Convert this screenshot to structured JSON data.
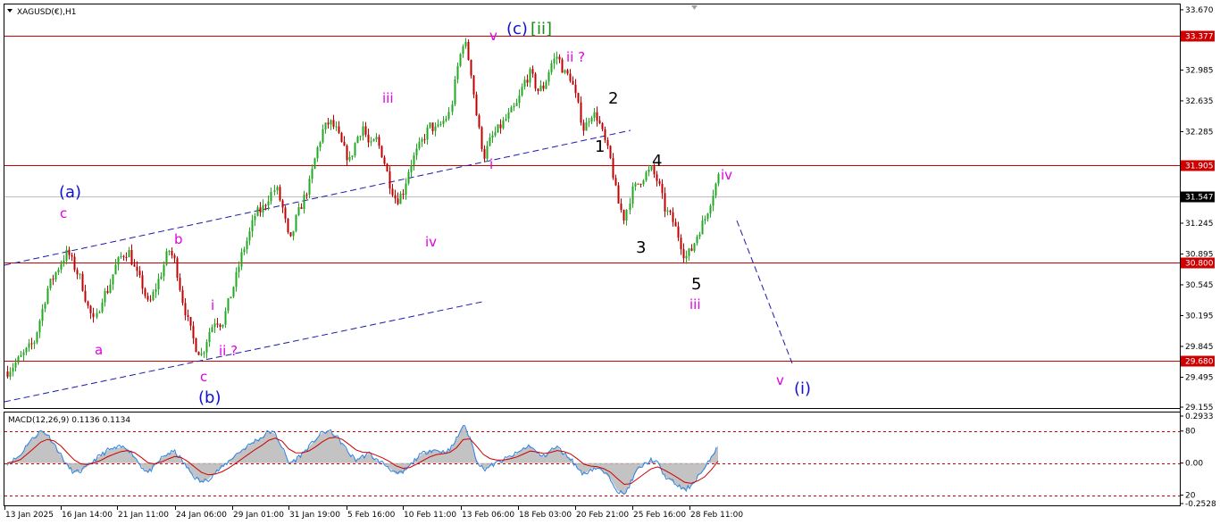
{
  "colors": {
    "frame": "#000000",
    "up_candle": "#22a822",
    "down_candle": "#c00000",
    "level": "#cc0000",
    "current_line": "#bfbfbf",
    "channel": "#1a1aaa",
    "wave_magenta": "#e000e0",
    "wave_blue": "#1010d0",
    "wave_green": "#178a17",
    "wave_black": "#000000",
    "macd_hist": "#b8b8b8",
    "macd_main": "#2a82e6",
    "macd_signal": "#cc0000"
  },
  "chart_data": {
    "type": "candlestick",
    "title": "XAGUSD(€),H1",
    "indicator_title": "MACD(12,26,9) 0.1136 0.1134",
    "y_ticks": [
      "33.670",
      "32.985",
      "32.635",
      "32.285",
      "31.245",
      "30.895",
      "30.545",
      "30.195",
      "29.845",
      "29.495",
      "29.155"
    ],
    "ylim": [
      29.155,
      33.72
    ],
    "x_ticks": [
      "13 Jan 2025",
      "16 Jan 14:00",
      "21 Jan 11:00",
      "24 Jan 06:00",
      "29 Jan 01:00",
      "31 Jan 19:00",
      "5 Feb 16:00",
      "10 Feb 11:00",
      "13 Feb 06:00",
      "18 Feb 03:00",
      "20 Feb 21:00",
      "25 Feb 16:00",
      "28 Feb 11:00"
    ],
    "levels": [
      {
        "value": 33.377,
        "label": "33.377"
      },
      {
        "value": 31.905,
        "label": "31.905"
      },
      {
        "value": 30.8,
        "label": "30.800"
      },
      {
        "value": 29.68,
        "label": "29.680"
      }
    ],
    "current_price": {
      "value": 31.547,
      "label": "31.547"
    },
    "path": [
      [
        0,
        29.56
      ],
      [
        2,
        29.72
      ],
      [
        4,
        29.9
      ],
      [
        6,
        30.5
      ],
      [
        8,
        30.8
      ],
      [
        9,
        30.92
      ],
      [
        10,
        30.75
      ],
      [
        11,
        30.6
      ],
      [
        12,
        30.3
      ],
      [
        13,
        30.1
      ],
      [
        14,
        30.4
      ],
      [
        15,
        30.5
      ],
      [
        16,
        30.75
      ],
      [
        17,
        30.88
      ],
      [
        18,
        30.93
      ],
      [
        19,
        30.7
      ],
      [
        20,
        30.55
      ],
      [
        21,
        30.3
      ],
      [
        22,
        30.5
      ],
      [
        23,
        30.7
      ],
      [
        24,
        30.95
      ],
      [
        25,
        30.8
      ],
      [
        26,
        30.4
      ],
      [
        27,
        30.1
      ],
      [
        28,
        29.85
      ],
      [
        29,
        29.74
      ],
      [
        30,
        30.0
      ],
      [
        31,
        30.15
      ],
      [
        32,
        30.1
      ],
      [
        33,
        30.35
      ],
      [
        34,
        30.6
      ],
      [
        35,
        30.9
      ],
      [
        36,
        31.1
      ],
      [
        37,
        31.35
      ],
      [
        38,
        31.4
      ],
      [
        39,
        31.55
      ],
      [
        40,
        31.65
      ],
      [
        41,
        31.4
      ],
      [
        42,
        31.0
      ],
      [
        43,
        31.3
      ],
      [
        44,
        31.5
      ],
      [
        45,
        31.7
      ],
      [
        46,
        32.05
      ],
      [
        47,
        32.3
      ],
      [
        48,
        32.4
      ],
      [
        49,
        32.3
      ],
      [
        50,
        32.1
      ],
      [
        51,
        31.95
      ],
      [
        52,
        32.2
      ],
      [
        53,
        32.35
      ],
      [
        54,
        32.1
      ],
      [
        55,
        32.2
      ],
      [
        56,
        32.0
      ],
      [
        57,
        31.7
      ],
      [
        58,
        31.5
      ],
      [
        59,
        31.6
      ],
      [
        60,
        31.9
      ],
      [
        61,
        32.05
      ],
      [
        62,
        32.2
      ],
      [
        63,
        32.35
      ],
      [
        64,
        32.3
      ],
      [
        65,
        32.4
      ],
      [
        66,
        32.5
      ],
      [
        67,
        33.0
      ],
      [
        68,
        33.35
      ],
      [
        69,
        33.0
      ],
      [
        70,
        32.4
      ],
      [
        71,
        32.0
      ],
      [
        72,
        32.2
      ],
      [
        73,
        32.3
      ],
      [
        74,
        32.4
      ],
      [
        75,
        32.5
      ],
      [
        76,
        32.6
      ],
      [
        77,
        32.85
      ],
      [
        78,
        32.95
      ],
      [
        79,
        32.75
      ],
      [
        80,
        32.8
      ],
      [
        81,
        33.05
      ],
      [
        82,
        33.15
      ],
      [
        83,
        32.95
      ],
      [
        84,
        32.9
      ],
      [
        85,
        32.6
      ],
      [
        86,
        32.3
      ],
      [
        87,
        32.5
      ],
      [
        88,
        32.45
      ],
      [
        89,
        32.2
      ],
      [
        90,
        31.95
      ],
      [
        91,
        31.5
      ],
      [
        92,
        31.3
      ],
      [
        93,
        31.6
      ],
      [
        94,
        31.7
      ],
      [
        95,
        31.8
      ],
      [
        96,
        31.85
      ],
      [
        97,
        31.7
      ],
      [
        98,
        31.4
      ],
      [
        99,
        31.3
      ],
      [
        100,
        31.1
      ],
      [
        101,
        30.85
      ],
      [
        102,
        30.95
      ],
      [
        103,
        31.15
      ],
      [
        104,
        31.3
      ],
      [
        105,
        31.55
      ],
      [
        106,
        31.78
      ]
    ],
    "annotations": [
      {
        "text": "(a)",
        "color": "wave_blue"
      },
      {
        "text": "c",
        "color": "wave_magenta"
      },
      {
        "text": "b",
        "color": "wave_magenta"
      },
      {
        "text": "a",
        "color": "wave_magenta"
      },
      {
        "text": "i",
        "color": "wave_magenta"
      },
      {
        "text": "ii ?",
        "color": "wave_magenta"
      },
      {
        "text": "c",
        "color": "wave_magenta"
      },
      {
        "text": "(b)",
        "color": "wave_blue"
      },
      {
        "text": "iii",
        "color": "wave_magenta"
      },
      {
        "text": "iv",
        "color": "wave_magenta"
      },
      {
        "text": "i",
        "color": "wave_magenta"
      },
      {
        "text": "v",
        "color": "wave_magenta"
      },
      {
        "text": "(c)",
        "color": "wave_blue"
      },
      {
        "text": "[ii]",
        "color": "wave_green"
      },
      {
        "text": "ii ?",
        "color": "wave_magenta"
      },
      {
        "text": "2",
        "color": "wave_black"
      },
      {
        "text": "1",
        "color": "wave_black"
      },
      {
        "text": "4",
        "color": "wave_black"
      },
      {
        "text": "iv",
        "color": "wave_magenta"
      },
      {
        "text": "3",
        "color": "wave_black"
      },
      {
        "text": "5",
        "color": "wave_black"
      },
      {
        "text": "iii",
        "color": "wave_magenta"
      },
      {
        "text": "v",
        "color": "wave_magenta"
      },
      {
        "text": "(i)",
        "color": "wave_blue"
      }
    ],
    "macd": {
      "y_ticks": [
        "0.2933",
        "80",
        "0.00",
        "20",
        "-0.2528"
      ],
      "ylim": [
        -0.2528,
        0.2933
      ],
      "macd_values": [
        0.0,
        0.02,
        0.05,
        0.12,
        0.16,
        0.2,
        0.18,
        0.12,
        0.05,
        -0.02,
        -0.06,
        -0.05,
        -0.02,
        0.02,
        0.05,
        0.08,
        0.09,
        0.1,
        0.09,
        0.04,
        -0.02,
        -0.06,
        -0.02,
        0.03,
        0.06,
        0.07,
        0.02,
        -0.04,
        -0.09,
        -0.12,
        -0.1,
        -0.06,
        -0.03,
        0.01,
        0.05,
        0.08,
        0.11,
        0.14,
        0.16,
        0.2,
        0.18,
        0.1,
        0.0,
        0.02,
        0.06,
        0.1,
        0.15,
        0.19,
        0.2,
        0.17,
        0.12,
        0.06,
        0.02,
        0.04,
        0.06,
        0.02,
        0.0,
        -0.03,
        -0.07,
        -0.06,
        -0.02,
        0.03,
        0.06,
        0.08,
        0.08,
        0.07,
        0.08,
        0.15,
        0.24,
        0.16,
        0.02,
        -0.04,
        -0.02,
        0.0,
        0.02,
        0.04,
        0.06,
        0.09,
        0.11,
        0.06,
        0.04,
        0.08,
        0.1,
        0.06,
        0.03,
        -0.03,
        -0.07,
        -0.04,
        -0.03,
        -0.06,
        -0.1,
        -0.17,
        -0.2,
        -0.12,
        -0.04,
        -0.01,
        0.02,
        0.0,
        -0.08,
        -0.11,
        -0.14,
        -0.17,
        -0.14,
        -0.08,
        -0.04,
        0.04,
        0.11
      ]
    }
  }
}
